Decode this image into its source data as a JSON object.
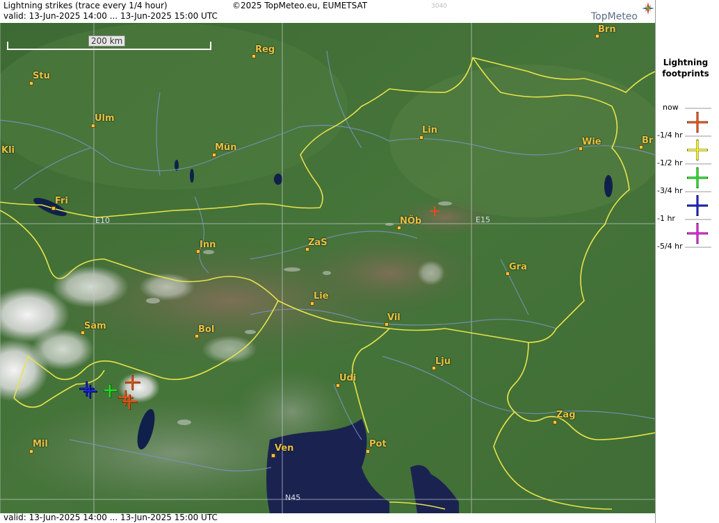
{
  "header": {
    "title": "Lightning strikes (trace every 1/4 hour)",
    "valid": "valid:  13-Jun-2025 14:00 ... 13-Jun-2025 15:00 UTC",
    "copyright": "©2025 TopMeteo.eu, EUMETSAT",
    "code": "3040",
    "logo": "TopMeteo"
  },
  "footer": {
    "valid": "valid:  13-Jun-2025 14:00 ... 13-Jun-2025 15:00 UTC"
  },
  "scale": {
    "label": "200 km"
  },
  "grid": {
    "e10": "E10",
    "e15": "E15",
    "n45": "N45"
  },
  "cities": [
    "Brn",
    "Reg",
    "Stu",
    "Ulm",
    "Lin",
    "Wie",
    "Br",
    "Kli",
    "Mün",
    "Fri",
    "NÖb",
    "Inn",
    "ZaS",
    "Gra",
    "Lie",
    "Vil",
    "Sam",
    "Bol",
    "Lju",
    "Udi",
    "Zag",
    "Mil",
    "Ven",
    "Pot"
  ],
  "legend": {
    "title_line1": "Lightning",
    "title_line2": "footprints",
    "items": [
      {
        "label": "now",
        "color": "#e0501a"
      },
      {
        "label": "-1/4 hr",
        "color": "#f2f21a"
      },
      {
        "label": "-1/2 hr",
        "color": "#22dd22"
      },
      {
        "label": "-3/4 hr",
        "color": "#1a22cc"
      },
      {
        "label": "-1 hr",
        "color": "#dd22dd"
      },
      {
        "label": "-5/4 hr",
        "color": ""
      }
    ]
  },
  "strikes": [
    {
      "color": "#e0501a",
      "age": "now"
    },
    {
      "color": "#f2f21a",
      "age": "-1/4 hr"
    },
    {
      "color": "#22dd22",
      "age": "-1/2 hr"
    },
    {
      "color": "#1a22cc",
      "age": "-3/4 hr"
    }
  ]
}
